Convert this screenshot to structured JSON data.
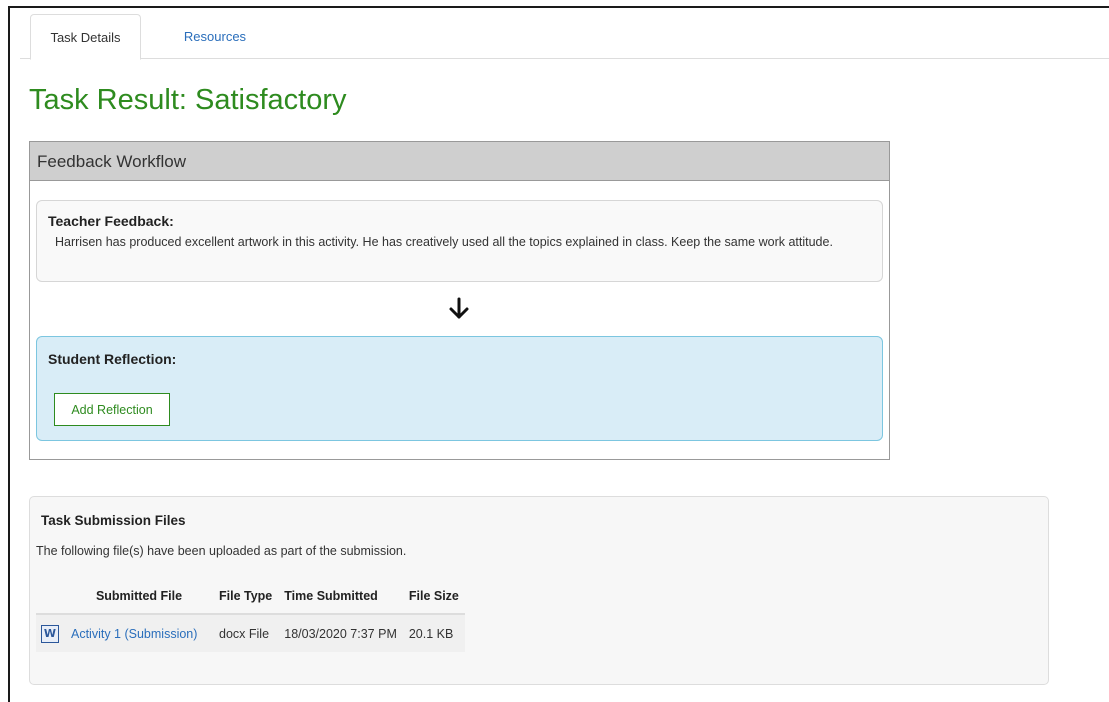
{
  "tabs": [
    {
      "label": "Task Details",
      "active": true
    },
    {
      "label": "Resources",
      "active": false
    }
  ],
  "page": {
    "title": "Task Result: Satisfactory"
  },
  "workflow": {
    "header": "Feedback Workflow",
    "teacher_feedback": {
      "heading": "Teacher Feedback:",
      "text": "Harrisen has produced excellent artwork in this activity. He has creatively used all the topics explained in class. Keep the same work attitude."
    },
    "arrow_icon": "arrow-down-icon",
    "student_reflection": {
      "heading": "Student Reflection:",
      "button_label": "Add Reflection"
    }
  },
  "submission": {
    "heading": "Task Submission Files",
    "description": "The following file(s) have been uploaded as part of the submission.",
    "columns": [
      "Submitted File",
      "File Type",
      "Time Submitted",
      "File Size"
    ],
    "files": [
      {
        "icon": "word-document-icon",
        "icon_glyph": "W",
        "name": "Activity 1 (Submission)",
        "type": "docx File",
        "time": "18/03/2020 7:37 PM",
        "size": "20.1 KB"
      }
    ]
  },
  "colors": {
    "title_green": "#2e8b1f",
    "link_blue": "#2a6ebb",
    "reflection_bg": "#d9edf7",
    "header_gray": "#cfcfcf"
  }
}
